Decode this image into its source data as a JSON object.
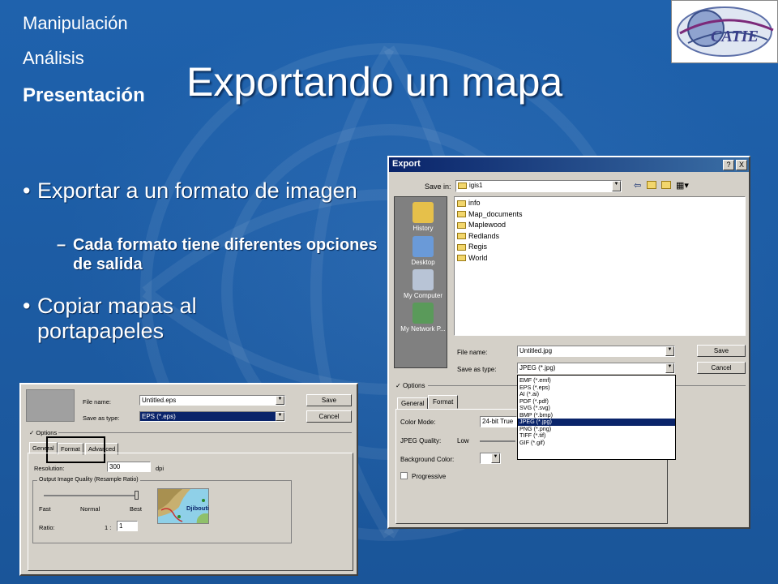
{
  "nav": {
    "item1": "Manipulación",
    "item2": "Análisis",
    "item3": "Presentación"
  },
  "title": "Exportando un mapa",
  "bullets": {
    "b1": "Exportar a un formato de imagen",
    "sub1": "Cada formato tiene diferentes opciones de salida",
    "b2": "Copiar mapas al portapapeles",
    "bullet_char": "•",
    "dash_char": "–"
  },
  "export": {
    "title": "Export",
    "help": "?",
    "close": "X",
    "save_in_label": "Save in:",
    "save_in_value": "igis1",
    "places": [
      "History",
      "Desktop",
      "My Computer",
      "My Network P..."
    ],
    "folders": [
      "info",
      "Map_documents",
      "Maplewood",
      "Redlands",
      "Regis",
      "World"
    ],
    "file_name_label": "File name:",
    "file_name_value": "Untitled.jpg",
    "save_type_label": "Save as type:",
    "save_type_value": "JPEG (*.jpg)",
    "save_btn": "Save",
    "cancel_btn": "Cancel",
    "options_label": "Options",
    "tabs": [
      "General",
      "Format"
    ],
    "types": [
      "EMF (*.emf)",
      "EPS (*.eps)",
      "AI (*.ai)",
      "PDF (*.pdf)",
      "SVG (*.svg)",
      "BMP (*.bmp)",
      "JPEG (*.jpg)",
      "PNG (*.png)",
      "TIFF (*.tif)",
      "GIF (*.gif)"
    ],
    "color_mode_label": "Color Mode:",
    "color_mode_value": "24-bit True",
    "quality_label": "JPEG Quality:",
    "quality_value": "Low",
    "bg_label": "Background Color:",
    "progressive_label": "Progressive"
  },
  "small": {
    "file_name_label": "File name:",
    "file_name_value": "Untitled.eps",
    "save_type_label": "Save as type:",
    "save_type_value": "EPS (*.eps)",
    "save_btn": "Save",
    "cancel_btn": "Cancel",
    "options_label": "Options",
    "tabs": [
      "General",
      "Format",
      "Advanced"
    ],
    "resolution_label": "Resolution:",
    "resolution_value": "300",
    "dpi": "dpi",
    "quality_group": "Output Image Quality (Resample Ratio)",
    "fast": "Fast",
    "normal": "Normal",
    "best": "Best",
    "ratio_label": "Ratio:",
    "ratio_prefix": "1 :",
    "ratio_value": "1",
    "map_label": "Djibouti"
  }
}
